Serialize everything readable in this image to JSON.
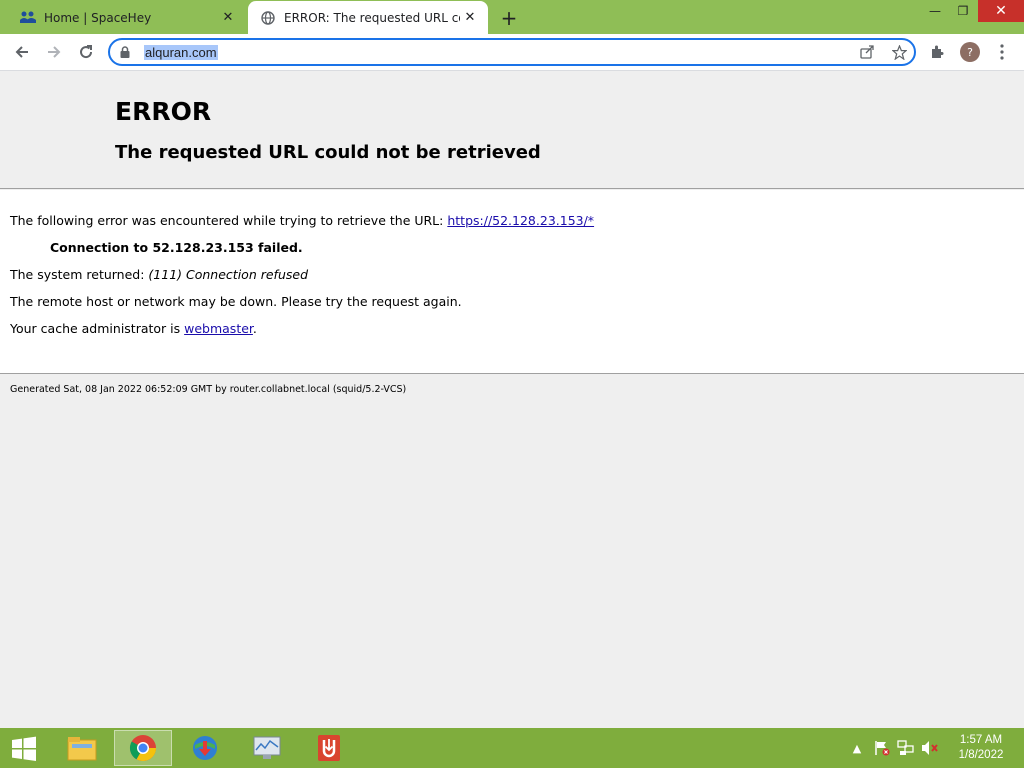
{
  "tabs": [
    {
      "title": "Home | SpaceHey",
      "favicon": "spacehey-people-icon",
      "active": false
    },
    {
      "title": "ERROR: The requested URL could not be retrieved",
      "favicon": "globe-icon",
      "active": true
    }
  ],
  "toolbar": {
    "url": "alquran.com",
    "profile_initial": "?"
  },
  "page": {
    "title": "ERROR",
    "subtitle": "The requested URL could not be retrieved",
    "line1_prefix": "The following error was encountered while trying to retrieve the URL: ",
    "line1_link": "https://52.128.23.153/*",
    "line2": "Connection to 52.128.23.153 failed.",
    "line3_prefix": "The system returned: ",
    "line3_error": "(111) Connection refused",
    "line4": "The remote host or network may be down. Please try the request again.",
    "line5_prefix": "Your cache administrator is ",
    "line5_link": "webmaster",
    "line5_suffix": ".",
    "footer": "Generated Sat, 08 Jan 2022 06:52:09 GMT by router.collabnet.local (squid/5.2-VCS)"
  },
  "taskbar": {
    "apps": [
      "file-explorer-icon",
      "chrome-icon",
      "internet-download-manager-icon",
      "system-monitor-icon",
      "uget-icon"
    ],
    "time": "1:57 AM",
    "date": "1/8/2022"
  },
  "colors": {
    "titlebar": "#8fbe56",
    "taskbar": "#7fad3d",
    "omnibox_border": "#1a73e8",
    "link": "#1a0dab"
  }
}
